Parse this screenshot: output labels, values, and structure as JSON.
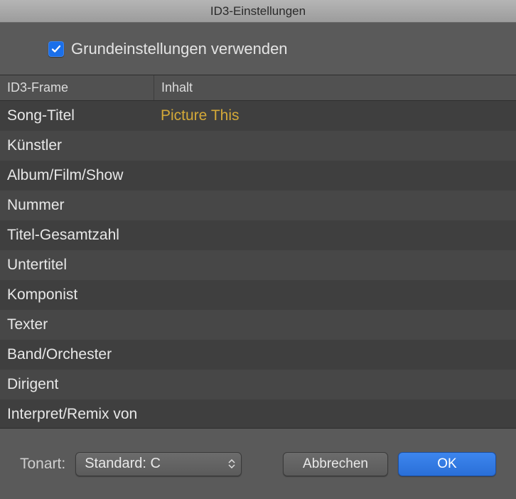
{
  "title": "ID3-Einstellungen",
  "useDefaults": {
    "label": "Grundeinstellungen verwenden",
    "checked": true
  },
  "columns": {
    "frame": "ID3-Frame",
    "content": "Inhalt"
  },
  "rows": [
    {
      "frame": "Song-Titel",
      "content": "Picture This"
    },
    {
      "frame": "Künstler",
      "content": ""
    },
    {
      "frame": "Album/Film/Show",
      "content": ""
    },
    {
      "frame": "Nummer",
      "content": ""
    },
    {
      "frame": "Titel-Gesamtzahl",
      "content": ""
    },
    {
      "frame": "Untertitel",
      "content": ""
    },
    {
      "frame": "Komponist",
      "content": ""
    },
    {
      "frame": "Texter",
      "content": ""
    },
    {
      "frame": "Band/Orchester",
      "content": ""
    },
    {
      "frame": "Dirigent",
      "content": ""
    },
    {
      "frame": "Interpret/Remix von",
      "content": ""
    }
  ],
  "footer": {
    "keyLabel": "Tonart:",
    "keyValue": "Standard: C",
    "cancel": "Abbrechen",
    "ok": "OK"
  }
}
